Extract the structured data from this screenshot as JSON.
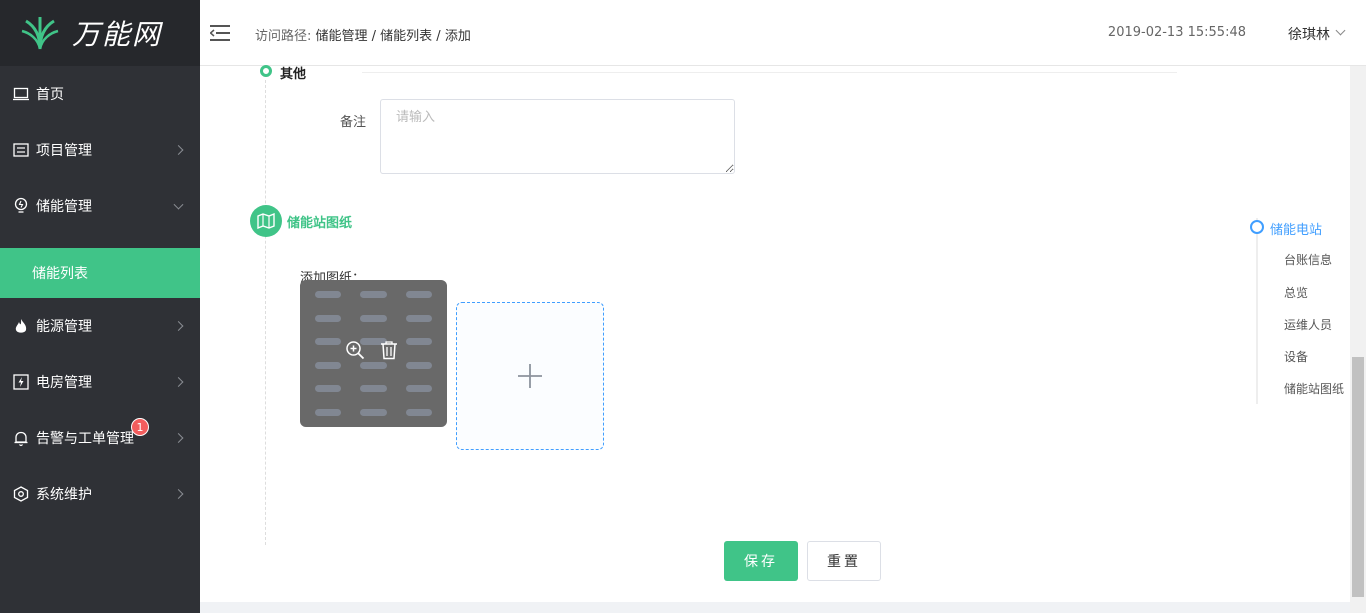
{
  "app": {
    "brand": "万能网"
  },
  "sidebar": {
    "items": [
      {
        "label": "首页",
        "icon": "monitor-icon"
      },
      {
        "label": "项目管理",
        "icon": "list-card-icon"
      },
      {
        "label": "储能管理",
        "icon": "bulb-icon"
      },
      {
        "label": "能源管理",
        "icon": "flame-icon"
      },
      {
        "label": "电房管理",
        "icon": "power-box-icon"
      },
      {
        "label": "告警与工单管理",
        "icon": "bell-icon",
        "badge": "1"
      },
      {
        "label": "系统维护",
        "icon": "hexagon-gear-icon"
      }
    ],
    "active_sub": "储能列表"
  },
  "header": {
    "breadcrumb_prefix": "访问路径:",
    "breadcrumb": "储能管理 / 储能列表 / 添加",
    "timestamp": "2019-02-13 15:55:48",
    "user": "徐琪林"
  },
  "form": {
    "section_other_title": "其他",
    "remark_label": "备注",
    "remark_placeholder": "请输入",
    "section_drawing_title": "储能站图纸",
    "drawing_label": "添加图纸："
  },
  "buttons": {
    "save": "保存",
    "reset": "重置"
  },
  "anchor_nav": {
    "items": [
      "储能电站",
      "台账信息",
      "总览",
      "运维人员",
      "设备",
      "储能站图纸"
    ],
    "active": "储能电站"
  },
  "colors": {
    "brand_green": "#40c488",
    "sidebar_bg": "#2f3136",
    "link_blue": "#409eff",
    "badge_red": "#f25d5d"
  }
}
